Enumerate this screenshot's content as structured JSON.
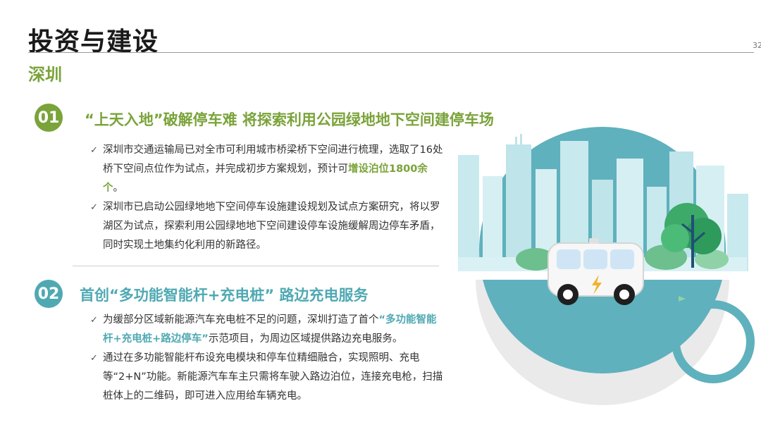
{
  "page": {
    "title": "投资与建设",
    "subtitle": "深圳",
    "page_number": "32"
  },
  "section1": {
    "number": "01",
    "heading": "“上天入地”破解停车难 将探索利用公园绿地地下空间建停车场",
    "bullet1": {
      "a": "深圳市交通运输局已对全市可利用城市桥梁桥下空间进行梳理，选取了16处桥下空间点位作为试点，并完成初步方案规划，预计可",
      "highlight": "增设泊位1800余个",
      "b": "。"
    },
    "bullet2": {
      "text": "深圳市已启动公园绿地地下空间停车设施建设规划及试点方案研究，将以罗湖区为试点，探索利用公园绿地地下空间建设停车设施缓解周边停车矛盾，同时实现土地集约化利用的新路径。"
    }
  },
  "section2": {
    "number": "02",
    "heading": "首创“多功能智能杆+充电桩” 路边充电服务",
    "bullet1": {
      "a": "为缓部分区域新能源汽车充电桩不足的问题，深圳打造了首个",
      "highlight": "“多功能智能杆+充电桩+路边停车”",
      "b": "示范项目，为周边区域提供路边充电服务。"
    },
    "bullet2": {
      "text": "通过在多功能智能杆布设充电模块和停车位精细融合，实现照明、充电等“2+N”功能。新能源汽车车主只需将车驶入路边泊位，连接充电枪，扫描桩体上的二维码，即可进入应用给车辆充电。"
    }
  },
  "colors": {
    "green": "#7aa33a",
    "teal": "#4fa9b3"
  }
}
